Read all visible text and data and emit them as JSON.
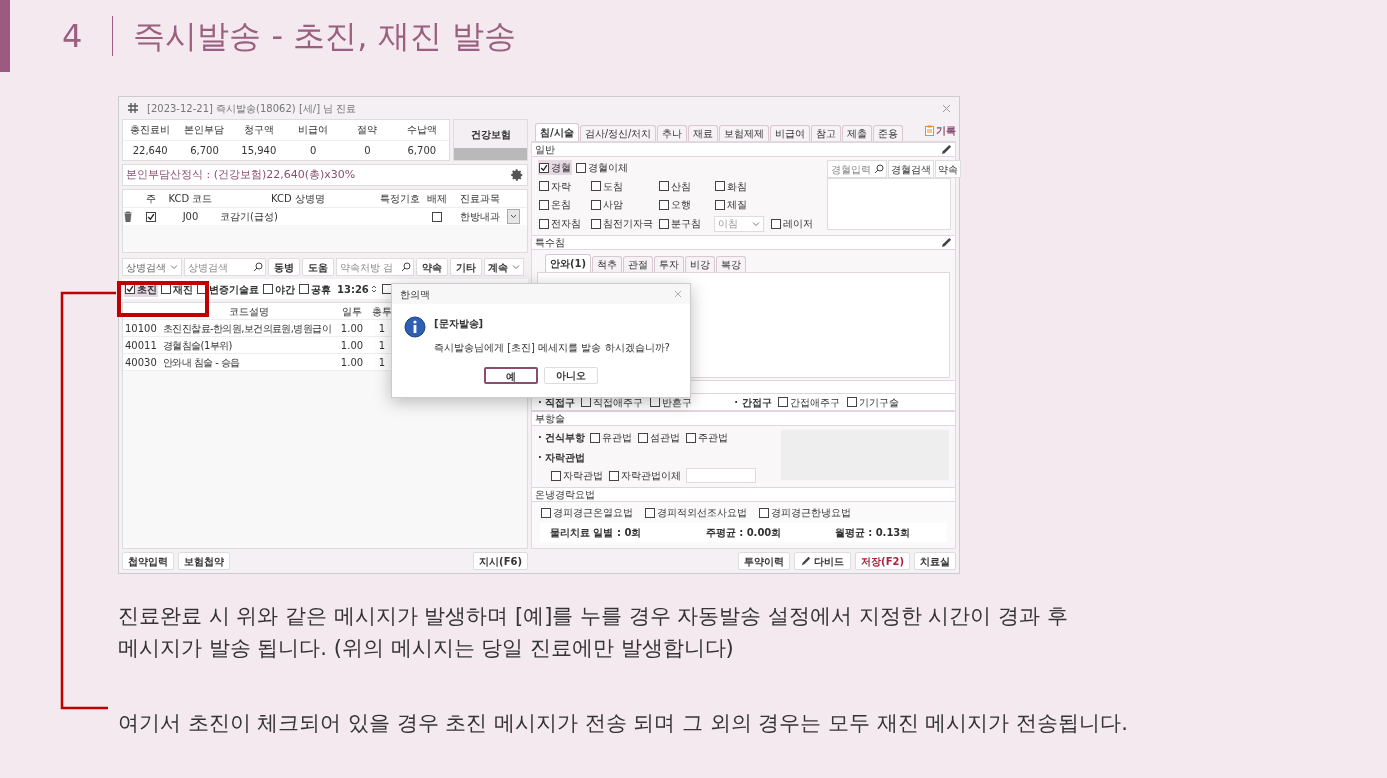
{
  "slide": {
    "number": "4",
    "title": "즉시발송 - 초진, 재진 발송"
  },
  "window": {
    "title": "[2023-12-21] 즉시발송(18062) [세/] 님 진료"
  },
  "summary": {
    "columns": [
      "총진료비",
      "본인부담",
      "청구액",
      "비급여",
      "절약",
      "수납액"
    ],
    "values": [
      "22,640",
      "6,700",
      "15,940",
      "0",
      "0",
      "6,700"
    ],
    "insurance": "건강보험"
  },
  "copay_formula": "본인부담산정식 : (건강보험)22,640(총)x30%",
  "diagnosis": {
    "columns": [
      "주",
      "KCD 코드",
      "KCD 상병명",
      "특정기호",
      "배제",
      "진료과목"
    ],
    "rows": [
      {
        "primary": true,
        "code": "J00",
        "name": "코감기(급성)",
        "excluded": false,
        "department": "한방내과"
      }
    ]
  },
  "search_bar": {
    "dropdown": "상병검색",
    "placeholder": "상병검색",
    "buttons": [
      "동병",
      "도움"
    ],
    "prescription_placeholder": "약속처방 검",
    "buttons2": [
      "약속",
      "기타"
    ],
    "dropdown2": "계속"
  },
  "visit_options": [
    {
      "label": "초진",
      "checked": true
    },
    {
      "label": "재진",
      "checked": false
    },
    {
      "label": "변증기술료",
      "checked": false
    },
    {
      "label": "야간",
      "checked": false
    },
    {
      "label": "공휴",
      "checked": false
    }
  ],
  "time": "13:26",
  "extra_checkbox": {
    "checked": false
  },
  "orders": {
    "columns": [
      "코드설명",
      "일투",
      "총투"
    ],
    "rows": [
      {
        "code": "10100",
        "description": "초진진찰료-한의원,보건의료원,병원급이",
        "daily": "1.00",
        "total": "1"
      },
      {
        "code": "40011",
        "description": "경혈침술(1부위)",
        "daily": "1.00",
        "total": "1"
      },
      {
        "code": "40030",
        "description": "안와내 침술 - 승읍",
        "daily": "1.00",
        "total": "1"
      }
    ]
  },
  "left_buttons": [
    "첩약입력",
    "보험첩약"
  ],
  "order_button": "지시(F6)",
  "tabs": [
    {
      "label": "침/시술",
      "selected": true
    },
    {
      "label": "검사/정신/처치",
      "selected": false
    },
    {
      "label": "추나",
      "selected": false
    },
    {
      "label": "재료",
      "selected": false
    },
    {
      "label": "보험제제",
      "selected": false
    },
    {
      "label": "비급여",
      "selected": false
    },
    {
      "label": "참고",
      "selected": false
    },
    {
      "label": "제출",
      "selected": false
    },
    {
      "label": "준용",
      "selected": false
    }
  ],
  "record_button": "기록",
  "general": {
    "title": "일반",
    "top_row": [
      {
        "label": "경혈",
        "checked": true
      },
      {
        "label": "경혈이체",
        "checked": false
      }
    ],
    "rows": [
      [
        {
          "label": "자락",
          "checked": false
        },
        {
          "label": "도침",
          "checked": false
        },
        {
          "label": "산침",
          "checked": false
        },
        {
          "label": "화침",
          "checked": false
        }
      ],
      [
        {
          "label": "온침",
          "checked": false
        },
        {
          "label": "사암",
          "checked": false
        },
        {
          "label": "오행",
          "checked": false
        },
        {
          "label": "체질",
          "checked": false
        }
      ],
      [
        {
          "label": "전자침",
          "checked": false
        },
        {
          "label": "침전기자극",
          "checked": false
        },
        {
          "label": "분구침",
          "checked": false
        }
      ]
    ],
    "select_placeholder": "이침",
    "laser": {
      "label": "레이저",
      "checked": false
    },
    "acupoint_placeholder": "경혈입력",
    "buttons": [
      "경혈검색",
      "약속"
    ]
  },
  "special": {
    "title": "특수침",
    "tabs": [
      {
        "label": "안와(1)",
        "selected": true
      },
      {
        "label": "척추",
        "selected": false
      },
      {
        "label": "관절",
        "selected": false
      },
      {
        "label": "투자",
        "selected": false
      },
      {
        "label": "비강",
        "selected": false
      },
      {
        "label": "복강",
        "selected": false
      }
    ]
  },
  "moxa": [
    {
      "label": "· 직접구",
      "options": [
        {
          "label": "직접애주구",
          "checked": false
        },
        {
          "label": "반흔구",
          "checked": false
        }
      ]
    },
    {
      "label": "· 간접구",
      "options": [
        {
          "label": "간접애주구",
          "checked": false
        },
        {
          "label": "기기구술",
          "checked": false
        }
      ]
    }
  ],
  "cupping": {
    "title": "부항술",
    "groups": [
      {
        "label": "· 건식부항",
        "options": [
          {
            "label": "유관법",
            "checked": false
          },
          {
            "label": "섬관법",
            "checked": false
          },
          {
            "label": "주관법",
            "checked": false
          }
        ]
      },
      {
        "label": "· 자락관법",
        "options": [
          {
            "label": "자락관법",
            "checked": false
          },
          {
            "label": "자락관법이체",
            "checked": false
          }
        ]
      }
    ]
  },
  "thermo": {
    "title": "온냉경락요법",
    "options": [
      {
        "label": "경피경근온열요법",
        "checked": false
      },
      {
        "label": "경피적외선조사요법",
        "checked": false
      },
      {
        "label": "경피경근한냉요법",
        "checked": false
      }
    ],
    "stats": [
      "물리치료 일별 : 0회",
      "주평균 : 0.00회",
      "월평균 : 0.13회"
    ]
  },
  "bottom_buttons": [
    {
      "label": "투약이력",
      "kind": "plain"
    },
    {
      "label": "다비드",
      "kind": "pen"
    },
    {
      "label": "저장(F2)",
      "kind": "primary"
    },
    {
      "label": "치료실",
      "kind": "plain"
    }
  ],
  "dialog": {
    "title": "한의맥",
    "heading": "[문자발송]",
    "message": "즉시발송님에게 [초진] 메세지를 발송 하시겠습니까?",
    "buttons": [
      {
        "label": "예",
        "default": true
      },
      {
        "label": "아니오",
        "default": false
      }
    ]
  },
  "notes": [
    "진료완료 시 위와 같은 메시지가 발생하며 [예]를 누를 경우 자동발송 설정에서 지정한 시간이 경과 후",
    "메시지가 발송 됩니다. (위의 메시지는 당일 진료에만 발생합니다)"
  ],
  "callout": "여기서 초진이 체크되어 있을 경우 초진 메시지가 전송 되며 그 외의 경우는 모두 재진 메시지가 전송됩니다."
}
